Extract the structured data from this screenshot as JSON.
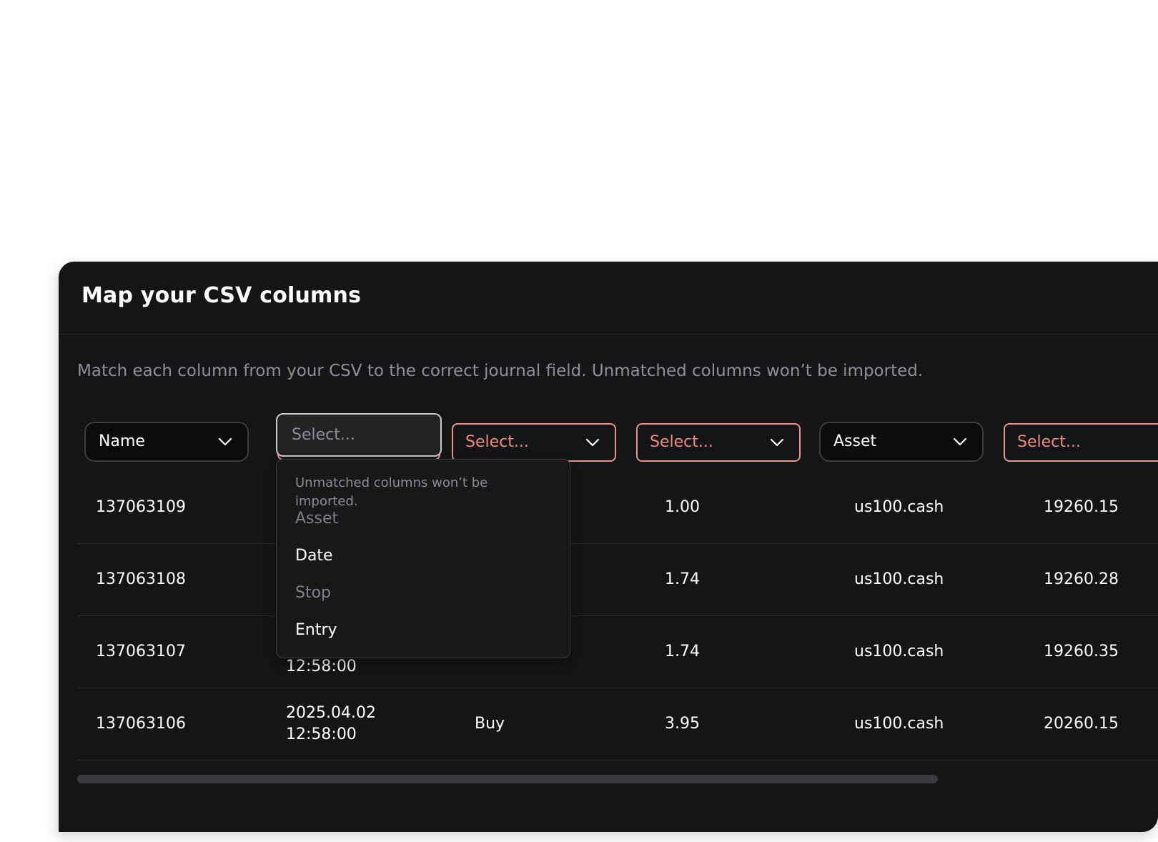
{
  "dialog": {
    "title": "Map your CSV columns",
    "description": "Match each column from your CSV to the correct journal field. Unmatched columns won’t be imported."
  },
  "mappings": [
    {
      "value": "Name",
      "state": "mapped",
      "icon": "chevron-down-icon"
    },
    {
      "value": "",
      "placeholder": "Select...",
      "state": "open"
    },
    {
      "value": "Select...",
      "state": "unmapped",
      "icon": "chevron-down-icon"
    },
    {
      "value": "Select...",
      "state": "unmapped",
      "icon": "chevron-down-icon"
    },
    {
      "value": "Asset",
      "state": "mapped",
      "icon": "chevron-down-icon"
    },
    {
      "value": "Select...",
      "state": "unmapped"
    }
  ],
  "rows": [
    [
      "137063109",
      "",
      "",
      "1.00",
      "us100.cash",
      "19260.15"
    ],
    [
      "137063108",
      "",
      "",
      "1.74",
      "us100.cash",
      "19260.28"
    ],
    [
      "137063107",
      "12:58:00",
      "",
      "1.74",
      "us100.cash",
      "19260.35"
    ],
    [
      "137063106",
      "2025.04.02\n12:58:00",
      "Buy",
      "3.95",
      "us100.cash",
      "20260.15"
    ]
  ],
  "dropdown": {
    "note": "Unmatched columns won’t be imported.",
    "options": [
      {
        "label": "Asset",
        "disabled": true
      },
      {
        "label": "Date",
        "disabled": false
      },
      {
        "label": "Stop",
        "disabled": true
      },
      {
        "label": "Entry",
        "disabled": false
      }
    ]
  },
  "colors": {
    "panel_bg": "#141517",
    "error_border": "#e7958d",
    "error_text": "#ef8a80",
    "muted_text": "#8e9096"
  }
}
